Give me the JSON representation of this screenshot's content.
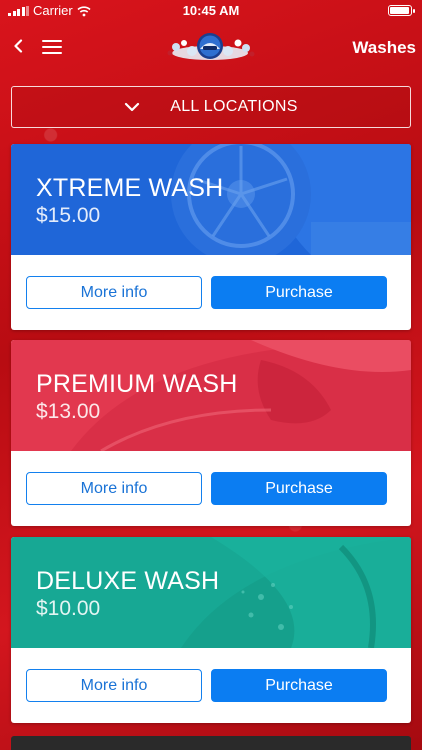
{
  "status_bar": {
    "carrier": "Carrier",
    "time": "10:45 AM",
    "battery_level": 0.95
  },
  "nav": {
    "title": "Washes"
  },
  "location_selector": {
    "label": "ALL LOCATIONS"
  },
  "washes": [
    {
      "name": "XTREME WASH",
      "price": "$15.00",
      "more_info_label": "More info",
      "purchase_label": "Purchase",
      "color": "#1f66d8"
    },
    {
      "name": "PREMIUM WASH",
      "price": "$13.00",
      "more_info_label": "More info",
      "purchase_label": "Purchase",
      "color": "#e2384f"
    },
    {
      "name": "DELUXE WASH",
      "price": "$10.00",
      "more_info_label": "More info",
      "purchase_label": "Purchase",
      "color": "#17a894"
    }
  ],
  "colors": {
    "background": "#c8121a",
    "accent": "#0b7df2"
  }
}
